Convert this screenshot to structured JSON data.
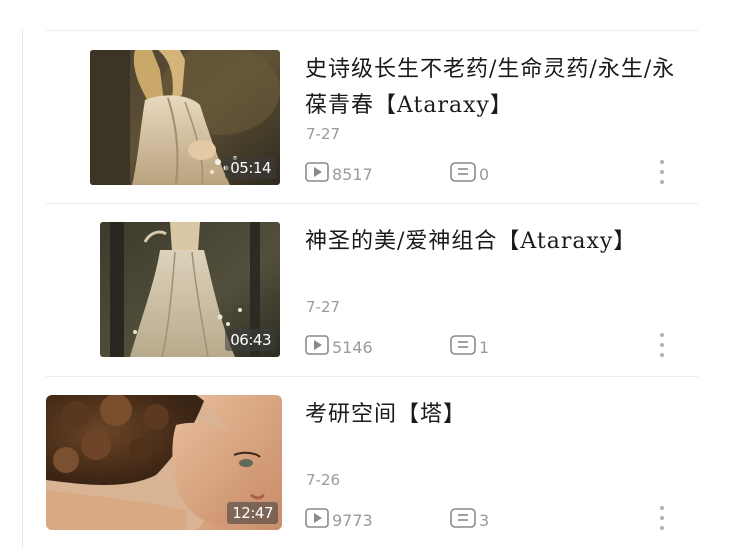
{
  "videos": [
    {
      "title": "史诗级长生不老药/生命灵药/永生/永葆青春【Ataraxy】",
      "duration": "05:14",
      "date": "7-27",
      "plays": "8517",
      "comments": "0",
      "thumb_icon": "painting-woman-in-white-dress-thumbnail"
    },
    {
      "title": "神圣的美/爱神组合【Ataraxy】",
      "duration": "06:43",
      "date": "7-27",
      "plays": "5146",
      "comments": "1",
      "thumb_icon": "painting-woman-in-forest-thumbnail"
    },
    {
      "title": "考研空间【塔】",
      "duration": "12:47",
      "date": "7-26",
      "plays": "9773",
      "comments": "3",
      "thumb_icon": "woman-curly-hair-portrait-thumbnail"
    }
  ],
  "icons": {
    "play": "play-count-icon",
    "comment": "comment-count-icon",
    "more": "more-options-icon"
  },
  "colors": {
    "text": "#1a1a1a",
    "meta": "#9a9a9a",
    "divider": "#ececec"
  }
}
